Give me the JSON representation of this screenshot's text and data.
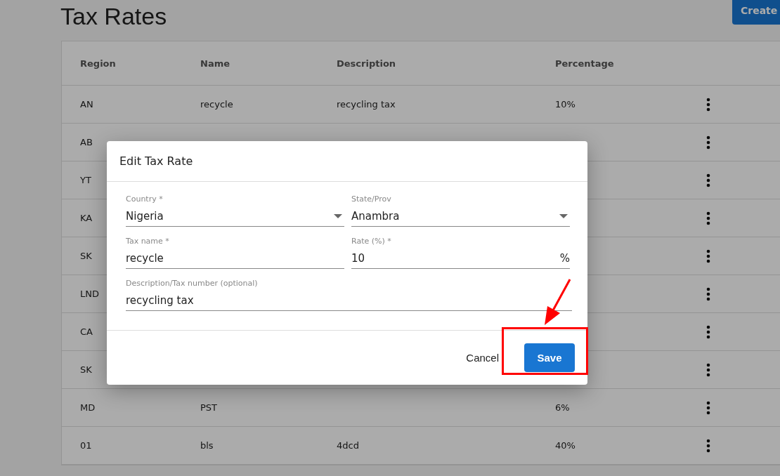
{
  "page": {
    "title": "Tax Rates",
    "create_button": "Create"
  },
  "table": {
    "columns": [
      "Region",
      "Name",
      "Description",
      "Percentage"
    ],
    "rows": [
      {
        "region": "AN",
        "name": "recycle",
        "description": "recycling tax",
        "percentage": "10%"
      },
      {
        "region": "AB"
      },
      {
        "region": "YT"
      },
      {
        "region": "KA"
      },
      {
        "region": "SK"
      },
      {
        "region": "LND"
      },
      {
        "region": "CA"
      },
      {
        "region": "SK"
      },
      {
        "region": "MD",
        "name": "PST",
        "percentage": "6%"
      },
      {
        "region": "01",
        "name": "bls",
        "description": "4dcd",
        "percentage": "40%"
      }
    ]
  },
  "dialog": {
    "title": "Edit Tax Rate",
    "fields": [
      {
        "kind": "select",
        "label": "Country *",
        "value": "Nigeria"
      },
      {
        "kind": "select",
        "label": "State/Prov",
        "value": "Anambra"
      },
      {
        "kind": "text",
        "label": "Tax name *",
        "value": "recycle"
      },
      {
        "kind": "suffix",
        "label": "Rate (%) *",
        "value": "10",
        "suffix": "%"
      },
      {
        "kind": "wide",
        "label": "Description/Tax number (optional)",
        "value": "recycling tax"
      }
    ],
    "buttons": [
      {
        "kind": "text",
        "label": "Cancel"
      },
      {
        "kind": "primary",
        "label": "Save"
      }
    ]
  }
}
